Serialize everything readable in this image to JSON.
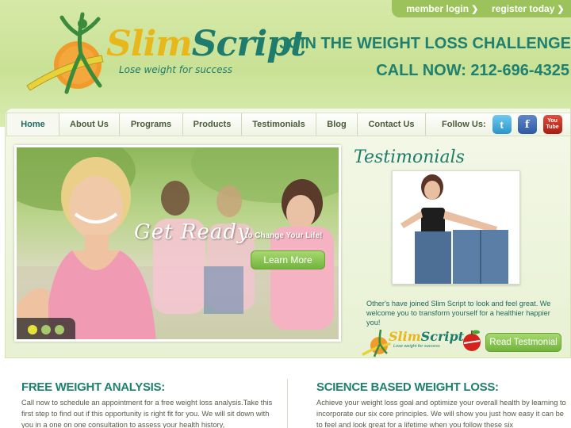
{
  "header": {
    "member_login": "member login",
    "register_today": "register today",
    "logo_name_part1": "Slim",
    "logo_name_part2": "Script",
    "logo_tagline": "Lose weight for success",
    "cta_line1": "JOIN THE WEIGHT LOSS CHALLENGE",
    "cta_line2": "CALL NOW: 212-696-4325"
  },
  "nav": {
    "items": [
      {
        "label": "Home",
        "active": true
      },
      {
        "label": "About Us"
      },
      {
        "label": "Programs"
      },
      {
        "label": "Products"
      },
      {
        "label": "Testimonials"
      },
      {
        "label": "Blog"
      },
      {
        "label": "Contact Us"
      }
    ],
    "follow_label": "Follow Us:",
    "social": [
      {
        "name": "twitter-icon",
        "glyph": "t"
      },
      {
        "name": "facebook-icon",
        "glyph": "f"
      },
      {
        "name": "youtube-icon",
        "glyph": "You Tube"
      }
    ]
  },
  "hero": {
    "headline": "Get Ready",
    "subline": "to Change Your Life!",
    "button": "Learn More",
    "slides": 3,
    "active_slide": 1
  },
  "testimonials": {
    "title": "Testimonials",
    "text": "Other's have joined Slim Script to look and feel great. We welcome you to transform yourself for a healthier happier you!",
    "mini_logo_part1": "Slim",
    "mini_logo_part2": "Script",
    "mini_logo_tag": "Lose weight for success",
    "button": "Read Testmonial"
  },
  "content": {
    "left_title": "FREE WEIGHT ANALYSIS:",
    "left_text": "Call now to schedule an appointment for a free weight loss analysis.Take this first step to find out if this opportunity is right fit for you. We will sit down with you in a one on one consultation to assess your health history,",
    "right_title": "SCIENCE BASED WEIGHT LOSS:",
    "right_text": "Achieve your weight loss goal and optimize your overall health by learning to incorporate our six core principles. We will show you just how easy it can be to feel and look great for a lifetime when you follow these six"
  },
  "colors": {
    "brand_teal": "#1f7b6c",
    "brand_gold": "#e8b81a",
    "button_green": "#72b33e"
  }
}
